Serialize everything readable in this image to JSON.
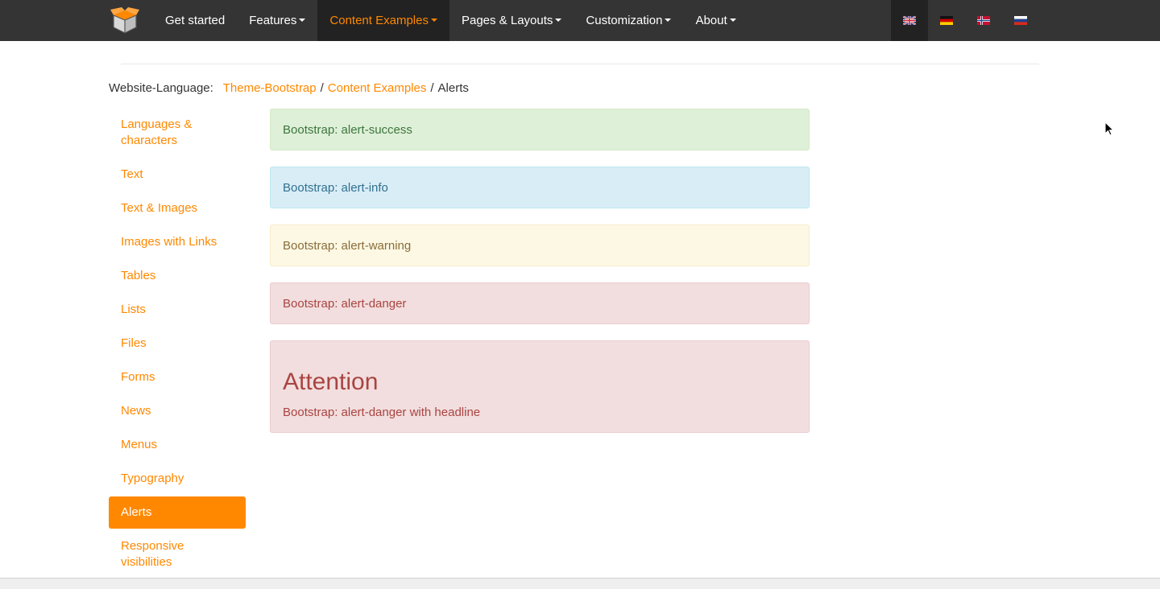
{
  "nav": {
    "logo_icon": "box-logo-icon",
    "items": [
      {
        "label": "Get started",
        "caret": false,
        "active": false
      },
      {
        "label": "Features",
        "caret": true,
        "active": false
      },
      {
        "label": "Content Examples",
        "caret": true,
        "active": true
      },
      {
        "label": "Pages & Layouts",
        "caret": true,
        "active": false
      },
      {
        "label": "Customization",
        "caret": true,
        "active": false
      },
      {
        "label": "About",
        "caret": true,
        "active": false
      }
    ],
    "languages": [
      {
        "code": "en",
        "icon": "uk-flag-icon",
        "active": true
      },
      {
        "code": "de",
        "icon": "german-flag-icon",
        "active": false
      },
      {
        "code": "no",
        "icon": "norwegian-flag-icon",
        "active": false
      },
      {
        "code": "ru",
        "icon": "russian-flag-icon",
        "active": false
      }
    ]
  },
  "breadcrumb": {
    "label": "Website-Language:",
    "crumb1": "Theme-Bootstrap",
    "crumb2": "Content Examples",
    "current": "Alerts",
    "separator": "/"
  },
  "sidebar": {
    "items": [
      {
        "label": "Languages & characters",
        "active": false
      },
      {
        "label": "Text",
        "active": false
      },
      {
        "label": "Text & Images",
        "active": false
      },
      {
        "label": "Images with Links",
        "active": false
      },
      {
        "label": "Tables",
        "active": false
      },
      {
        "label": "Lists",
        "active": false
      },
      {
        "label": "Files",
        "active": false
      },
      {
        "label": "Forms",
        "active": false
      },
      {
        "label": "News",
        "active": false
      },
      {
        "label": "Menus",
        "active": false
      },
      {
        "label": "Typography",
        "active": false
      },
      {
        "label": "Alerts",
        "active": true
      },
      {
        "label": "Responsive visibilities",
        "active": false
      }
    ]
  },
  "alerts": {
    "success": "Bootstrap: alert-success",
    "info": "Bootstrap: alert-info",
    "warning": "Bootstrap: alert-warning",
    "danger": "Bootstrap: alert-danger",
    "danger_headline": {
      "heading": "Attention",
      "text": "Bootstrap: alert-danger with headline"
    }
  },
  "colors": {
    "accent": "#ff8800",
    "navbar": "#343434",
    "success_bg": "#dff0d8",
    "info_bg": "#d9edf7",
    "warning_bg": "#fcf8e3",
    "danger_bg": "#f2dede"
  }
}
